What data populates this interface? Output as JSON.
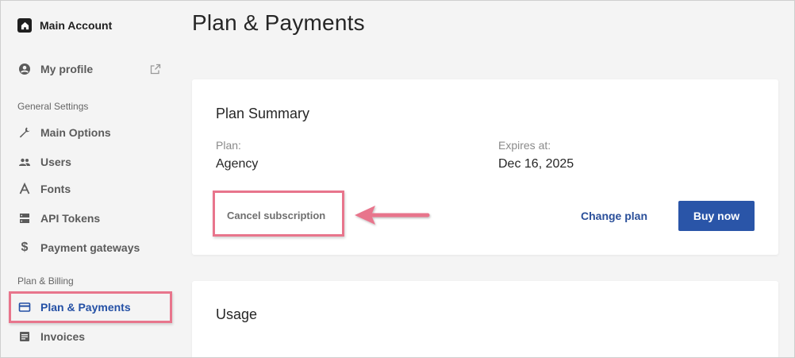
{
  "sidebar": {
    "account_name": "Main Account",
    "profile_label": "My profile",
    "sections": {
      "general": "General Settings",
      "billing": "Plan & Billing"
    },
    "general_items": [
      {
        "label": "Main Options",
        "icon": "wrench-icon"
      },
      {
        "label": "Users",
        "icon": "users-icon"
      },
      {
        "label": "Fonts",
        "icon": "font-icon"
      },
      {
        "label": "API Tokens",
        "icon": "token-icon"
      },
      {
        "label": "Payment gateways",
        "icon": "dollar-icon"
      }
    ],
    "billing_items": [
      {
        "label": "Plan & Payments",
        "icon": "credit-card-icon",
        "active": true
      },
      {
        "label": "Invoices",
        "icon": "invoice-icon"
      }
    ]
  },
  "main": {
    "title": "Plan & Payments",
    "plan_summary": {
      "title": "Plan Summary",
      "plan_label": "Plan:",
      "plan_value": "Agency",
      "expires_label": "Expires at:",
      "expires_value": "Dec 16, 2025",
      "cancel_label": "Cancel subscription",
      "change_label": "Change plan",
      "buy_label": "Buy now"
    },
    "usage": {
      "title": "Usage"
    }
  },
  "colors": {
    "accent": "#2a55a8",
    "highlight": "#e8758c",
    "active_text": "#2450a5"
  }
}
